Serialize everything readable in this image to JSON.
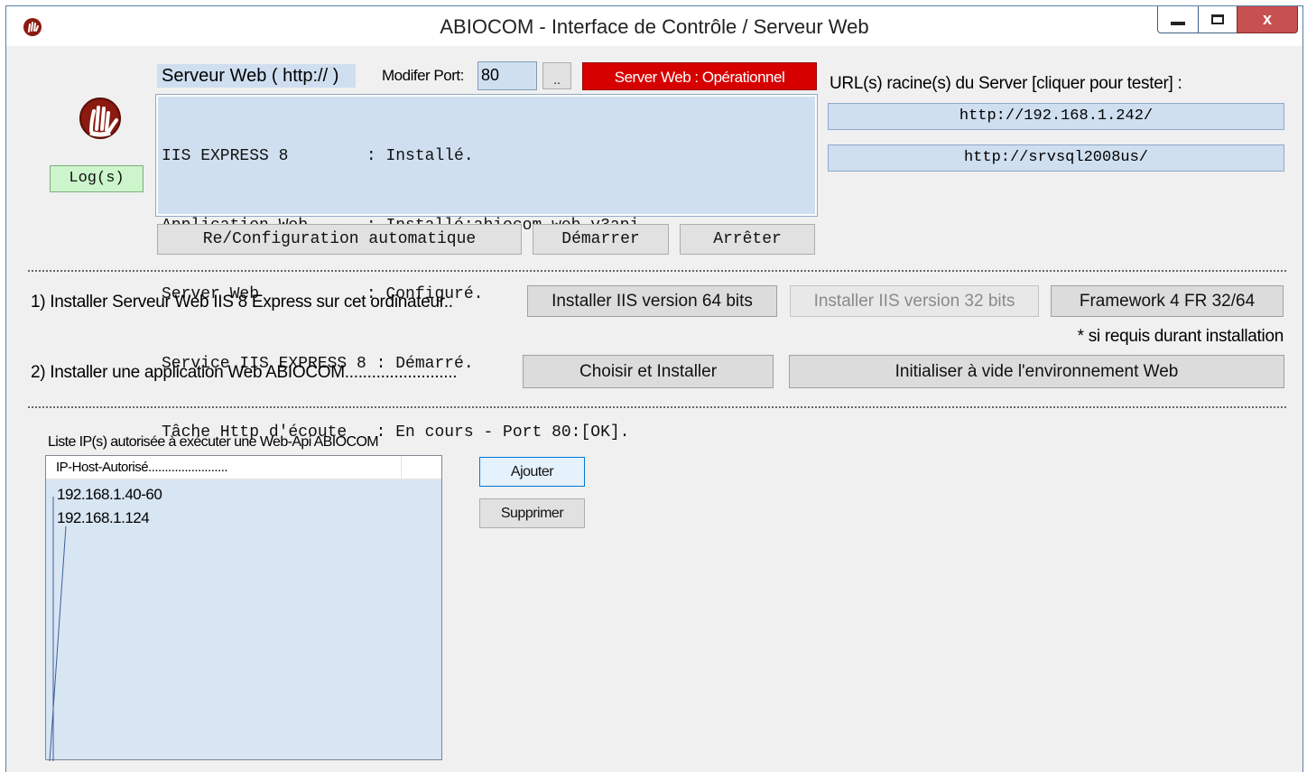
{
  "window": {
    "title": "ABIOCOM - Interface de Contrôle / Serveur Web",
    "app_icon": "abiocom-hand-icon",
    "controls": {
      "minimize_icon": "minimize-icon",
      "maximize_icon": "maximize-icon",
      "close_label": "x"
    }
  },
  "server": {
    "group_label": "Serveur Web ( http:// )",
    "port_label": "Modifer Port:",
    "port_value": "80",
    "port_browse": "..",
    "status_label": "Server Web : Opérationnel",
    "log_button": "Log(s)",
    "status_lines": [
      "IIS EXPRESS 8        : Installé.",
      "Application Web      : Installé:abiocom_web_v3api",
      "Server Web           : Configuré.",
      "Service IIS EXPRESS 8 : Démarré.",
      "Tâche Http d'écoute   : En cours - Port 80:[OK]."
    ],
    "buttons": {
      "reconfig": "Re/Configuration automatique",
      "start": "Démarrer",
      "stop": "Arrêter"
    }
  },
  "urls": {
    "label": "URL(s) racine(s) du Server  [cliquer pour tester] :",
    "items": [
      "http://192.168.1.242/",
      "http://srvsql2008us/"
    ]
  },
  "install": {
    "step1_label": "1) Installer Serveur Web IIS 8  Express sur cet ordinateur..",
    "iis64": "Installer IIS version 64 bits",
    "iis32": "Installer IIS version 32 bits",
    "framework": "Framework 4 FR 32/64",
    "note": "* si requis durant installation",
    "step2_label": "2) Installer une application Web ABIOCOM.........................",
    "choose_install": "Choisir et Installer",
    "init_env": "Initialiser à vide  l'environnement Web"
  },
  "ip_list": {
    "label": "Liste IP(s) autorisée à exécuter une Web-Api ABIOCOM",
    "column_header": "IP-Host-Autorisé........................",
    "rows": [
      "192.168.1.40-60",
      "192.168.1.124"
    ],
    "add_button": "Ajouter",
    "delete_button": "Supprimer"
  }
}
